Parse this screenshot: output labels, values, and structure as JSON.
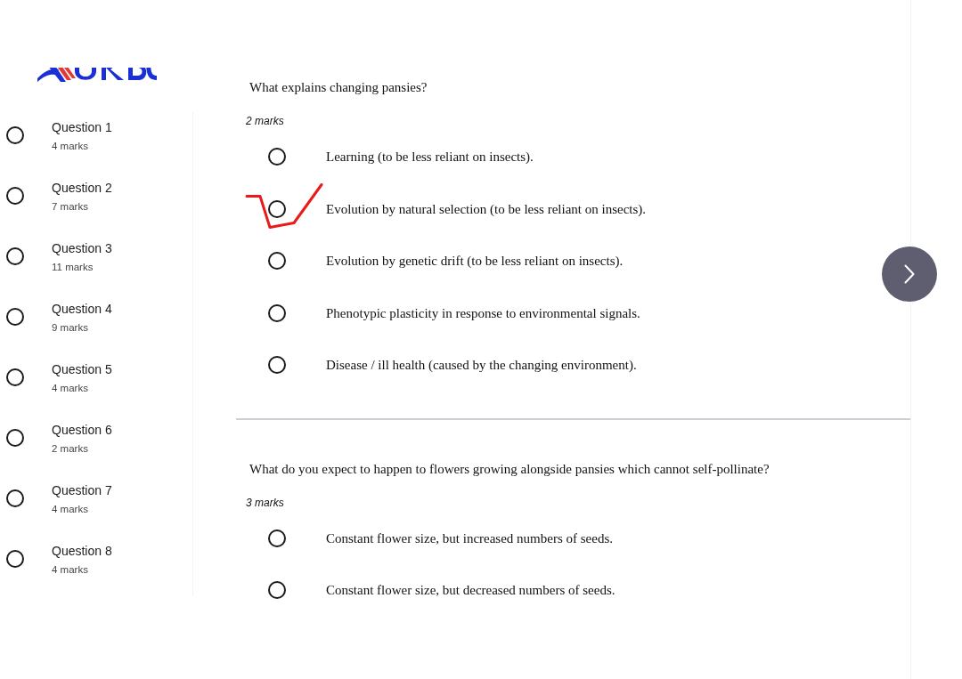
{
  "sidebar": {
    "items": [
      {
        "title": "Question 1",
        "marks": "4 marks",
        "checked": false
      },
      {
        "title": "Question 2",
        "marks": "7 marks",
        "checked": false
      },
      {
        "title": "Question 3",
        "marks": "11 marks",
        "checked": false
      },
      {
        "title": "Question 4",
        "marks": "9 marks",
        "checked": false
      },
      {
        "title": "Question 5",
        "marks": "4 marks",
        "checked": false
      },
      {
        "title": "Question 6",
        "marks": "2 marks",
        "checked": false
      },
      {
        "title": "Question 7",
        "marks": "4 marks",
        "checked": false
      },
      {
        "title": "Question 8",
        "marks": "4 marks",
        "checked": false
      }
    ]
  },
  "questions": [
    {
      "prompt": "What explains changing pansies?",
      "marks": "2 marks",
      "options": [
        {
          "text": "Learning (to be less reliant on insects).",
          "selected": false,
          "marked": false
        },
        {
          "text": "Evolution by natural selection (to be less reliant on insects).",
          "selected": false,
          "marked": true
        },
        {
          "text": "Evolution by genetic drift (to be less reliant on insects).",
          "selected": false,
          "marked": false
        },
        {
          "text": "Phenotypic plasticity in response to environmental signals.",
          "selected": false,
          "marked": false
        },
        {
          "text": "Disease / ill health (caused by the changing environment).",
          "selected": false,
          "marked": false
        }
      ]
    },
    {
      "prompt": "What do you expect to happen to flowers growing alongside pansies which cannot self-pollinate?",
      "marks": "3 marks",
      "options": [
        {
          "text": "Constant flower size, but increased numbers of seeds.",
          "selected": false,
          "marked": false
        },
        {
          "text": "Constant flower size, but decreased numbers of seeds.",
          "selected": false,
          "marked": false
        }
      ]
    }
  ]
}
